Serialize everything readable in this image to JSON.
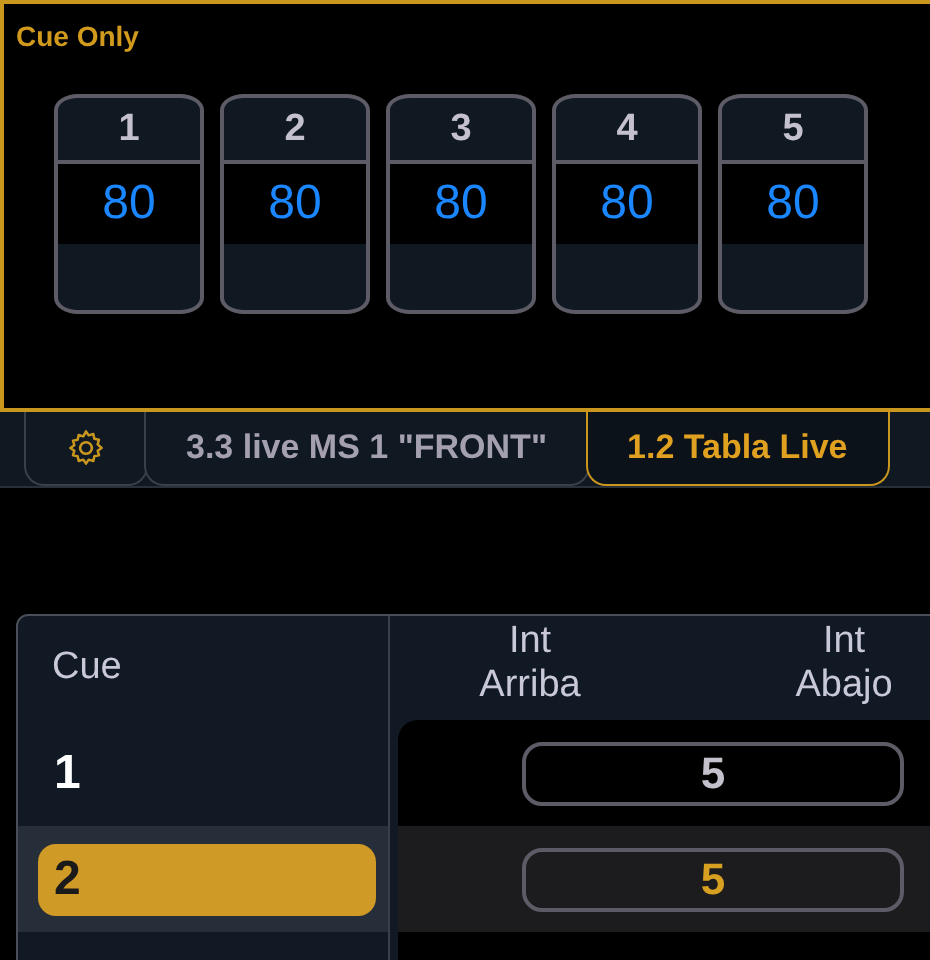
{
  "panel": {
    "title": "Cue Only",
    "faders": [
      {
        "number": "1",
        "value": "80"
      },
      {
        "number": "2",
        "value": "80"
      },
      {
        "number": "3",
        "value": "80"
      },
      {
        "number": "4",
        "value": "80"
      },
      {
        "number": "5",
        "value": "80"
      }
    ]
  },
  "tabs": [
    {
      "kind": "gear",
      "selected": false
    },
    {
      "kind": "text",
      "label": "3.3 live MS 1 \"FRONT\"",
      "selected": false
    },
    {
      "kind": "text",
      "label": "1.2 Tabla Live",
      "selected": true
    }
  ],
  "table": {
    "columns": [
      "Cue",
      "Int Arriba",
      "Int Abajo"
    ],
    "rows": [
      {
        "cue": "1",
        "value": "5",
        "selected": false
      },
      {
        "cue": "2",
        "value": "5",
        "selected": true
      }
    ]
  }
}
